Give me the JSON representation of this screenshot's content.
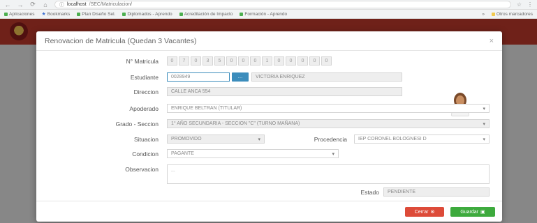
{
  "browser": {
    "url_host": "localhost",
    "url_path": "/SEC/Matriculacion/",
    "nav": [
      "←",
      "→",
      "⟳",
      "⌂"
    ],
    "right_icons": [
      "☆",
      "⋮"
    ]
  },
  "bookmarks": {
    "items": [
      "Aplicaciones",
      "Bookmarks",
      "Plan Diseño Sel.",
      "Diplomados - Aprendo",
      "Acreditación de Impacto",
      "Formación - Aprendo"
    ],
    "right": [
      "»",
      "Otros marcadores"
    ]
  },
  "modal": {
    "title": "Renovacion de Matricula (Quedan 3 Vacantes)",
    "close_icon": "×",
    "fields": {
      "matricula_label": "N° Matricula",
      "matricula_digits": [
        "0",
        "7",
        "0",
        "3",
        "5",
        "0",
        "0",
        "0",
        "1",
        "0",
        "0",
        "0",
        "0",
        "0"
      ],
      "estudiante_label": "Estudiante",
      "estudiante_code": "0028949",
      "search_icon": "…",
      "estudiante_name": "VICTORIA ENRIQUEZ",
      "direccion_label": "Direccion",
      "direccion_value": "CALLE ANCA 554",
      "apoderado_label": "Apoderado",
      "apoderado_value": "ENRIQUE BELTRAN (TITULAR)",
      "grado_label": "Grado - Seccion",
      "grado_value": "1° AÑO SECUNDARIA - SECCION \"C\" (TURNO MAÑANA)",
      "situacion_label": "Situacion",
      "situacion_value": "PROMOVIDO",
      "procedencia_label": "Procedencia",
      "procedencia_value": "IEP CORONEL BOLOGNESI D",
      "condicion_label": "Condicion",
      "condicion_value": "PAGANTE",
      "observacion_label": "Observacion",
      "observacion_placeholder": "...",
      "estado_label": "Estado",
      "estado_value": "PENDIENTE"
    },
    "footer": {
      "cancel_label": "Cerrar",
      "cancel_icon": "⊗",
      "save_label": "Guardar",
      "save_icon": "▣"
    }
  },
  "colors": {
    "header_red": "#c0392b",
    "primary_blue": "#3c8dbc",
    "cancel_red": "#dd4b39",
    "save_green": "#3daa3d"
  }
}
